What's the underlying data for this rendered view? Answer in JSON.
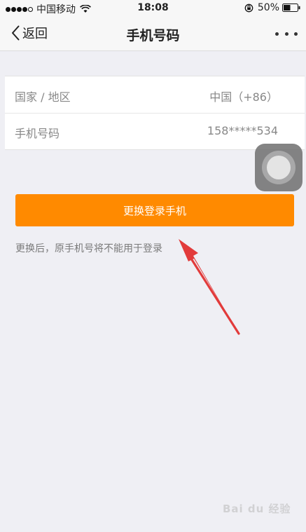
{
  "status_bar": {
    "carrier": "中国移动",
    "time": "18:08",
    "battery": "50%",
    "signal_strength": "4 of 5",
    "battery_level": 0.5
  },
  "nav": {
    "back_label": "返回",
    "title": "手机号码"
  },
  "form": {
    "rows": [
      {
        "label": "国家 / 地区",
        "value": "中国（+86）"
      },
      {
        "label": "手机号码",
        "value": "158*****534"
      }
    ]
  },
  "action": {
    "button_label": "更换登录手机",
    "hint": "更换后，原手机号将不能用于登录",
    "accent_color": "#ff8a00"
  },
  "annotation": {
    "arrow_color": "#e23b3b"
  },
  "watermark": {
    "text": "Bai du 经验"
  },
  "icons": [
    "signal-dots-icon",
    "wifi-icon",
    "rotation-lock-icon",
    "battery-icon",
    "back-chevron-icon",
    "more-dots-icon",
    "assistive-touch-icon",
    "red-arrow-annotation"
  ]
}
